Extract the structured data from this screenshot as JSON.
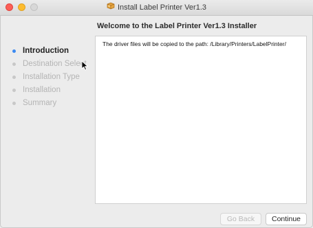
{
  "window": {
    "title": "Install Label Printer Ver1.3",
    "title_icon": "package-icon",
    "traffic_lights": {
      "close": "#fc5f57",
      "minimize": "#fdbc2e",
      "zoom": "#d8d8d8"
    }
  },
  "header": {
    "heading": "Welcome to the Label Printer Ver1.3 Installer"
  },
  "sidebar": {
    "steps": [
      {
        "label": "Introduction",
        "state": "active"
      },
      {
        "label": "Destination Select",
        "state": "pending"
      },
      {
        "label": "Installation Type",
        "state": "pending"
      },
      {
        "label": "Installation",
        "state": "pending"
      },
      {
        "label": "Summary",
        "state": "pending"
      }
    ],
    "active_color": "#3c8af1"
  },
  "main": {
    "message": "The driver files will be copied to the path: /Library/Printers/LabelPrinter/"
  },
  "footer": {
    "back_label": "Go Back",
    "continue_label": "Continue"
  }
}
